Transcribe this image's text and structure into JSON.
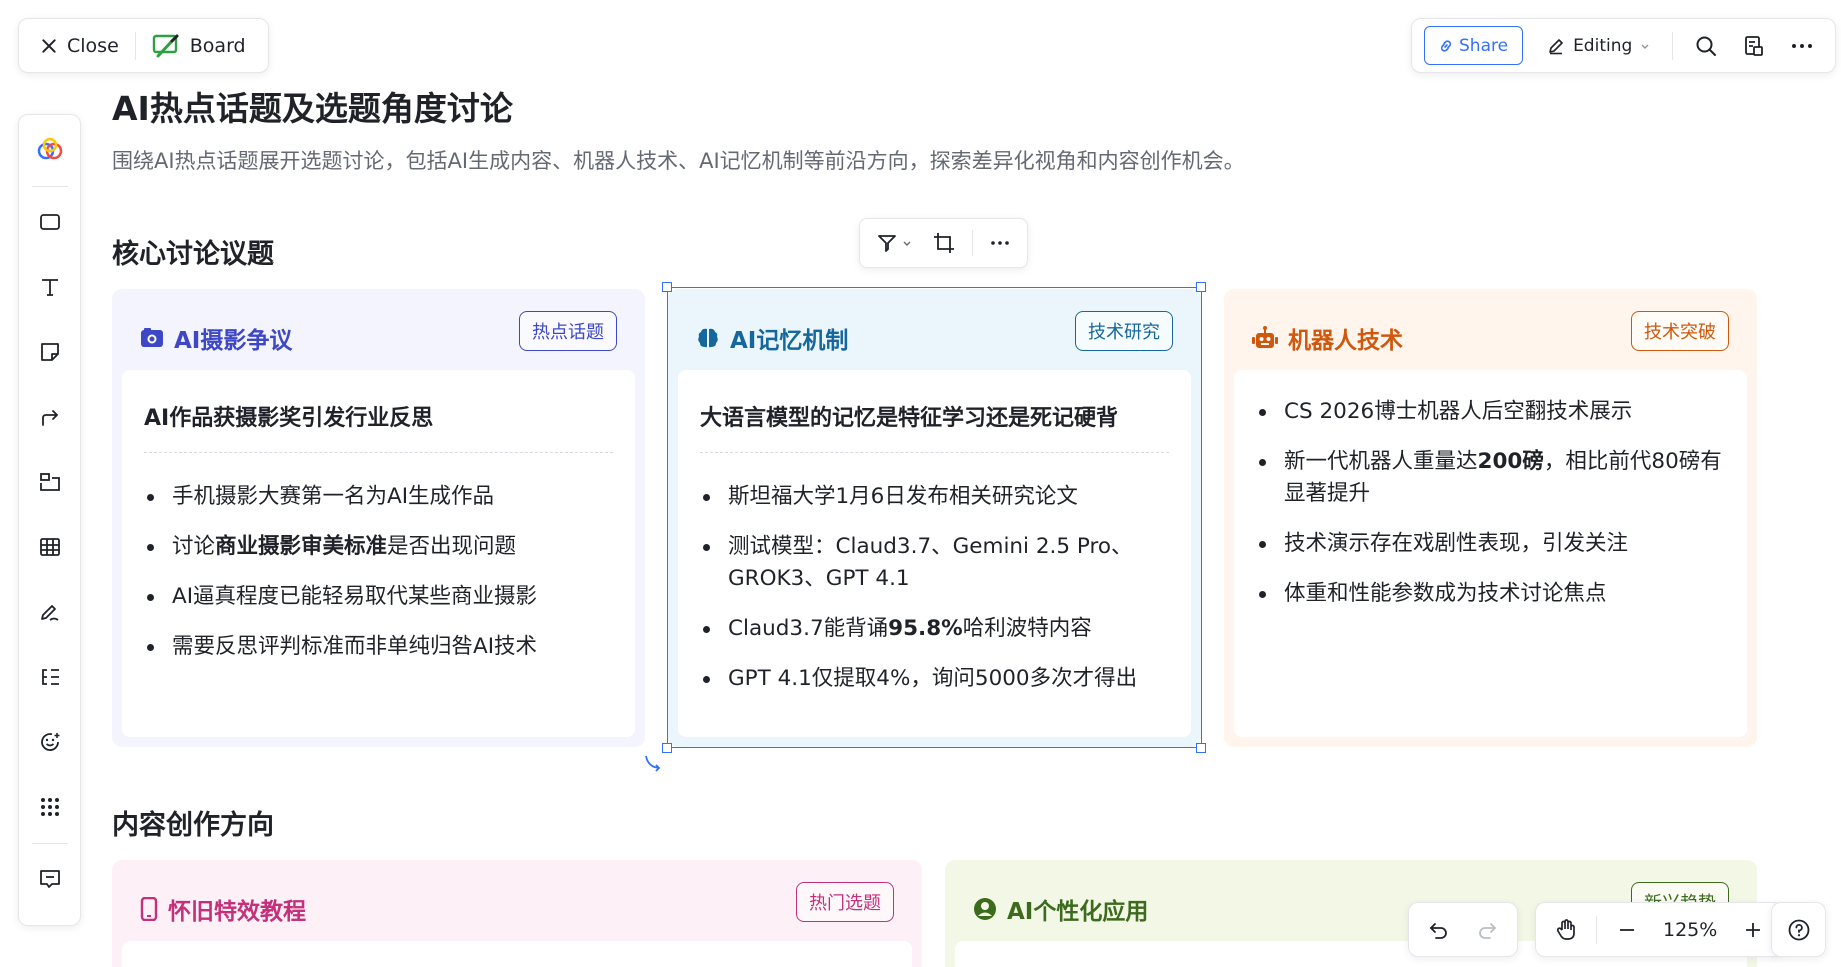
{
  "topbar": {
    "close_label": "Close",
    "board_label": "Board",
    "share_label": "Share",
    "editing_label": "Editing"
  },
  "document": {
    "title": "AI热点话题及选题角度讨论",
    "description": "围绕AI热点话题展开选题讨论，包括AI生成内容、机器人技术、AI记忆机制等前沿方向，探索差异化视角和内容创作机会。"
  },
  "sections": {
    "core": "核心讨论议题",
    "content": "内容创作方向"
  },
  "cards": {
    "photo": {
      "title": "AI摄影争议",
      "tag": "热点话题",
      "subtitle": "AI作品获摄影奖引发行业反思",
      "points": [
        {
          "text": "手机摄影大赛第一名为AI生成作品"
        },
        {
          "pre": "讨论",
          "bold": "商业摄影审美标准",
          "post": "是否出现问题"
        },
        {
          "text": "AI逼真程度已能轻易取代某些商业摄影"
        },
        {
          "text": "需要反思评判标准而非单纯归咎AI技术"
        }
      ]
    },
    "memory": {
      "title": "AI记忆机制",
      "tag": "技术研究",
      "subtitle": "大语言模型的记忆是特征学习还是死记硬背",
      "points": [
        {
          "text": "斯坦福大学1月6日发布相关研究论文"
        },
        {
          "text": "测试模型：Claud3.7、Gemini 2.5 Pro、GROK3、GPT 4.1"
        },
        {
          "pre": "Claud3.7能背诵",
          "bold": "95.8%",
          "post": "哈利波特内容"
        },
        {
          "text": "GPT 4.1仅提取4%，询问5000多次才得出"
        }
      ]
    },
    "robot": {
      "title": "机器人技术",
      "tag": "技术突破",
      "points": [
        {
          "text": "CS 2026博士机器人后空翻技术展示"
        },
        {
          "pre": "新一代机器人重量达",
          "bold": "200磅",
          "post": "，相比前代80磅有显著提升"
        },
        {
          "text": "技术演示存在戏剧性表现，引发关注"
        },
        {
          "text": "体重和性能参数成为技术讨论焦点"
        }
      ]
    },
    "nostalgia": {
      "title": "怀旧特效教程",
      "tag": "热门选题"
    },
    "personal": {
      "title": "AI个性化应用",
      "tag": "新兴趋势"
    }
  },
  "zoom": {
    "level": "125%"
  },
  "colors": {
    "accent": "#3370ff",
    "photo": "#3e48c7",
    "memory": "#16689c",
    "robot": "#d0580e",
    "nostalgia": "#c4307a",
    "personal": "#3d6b1d"
  }
}
